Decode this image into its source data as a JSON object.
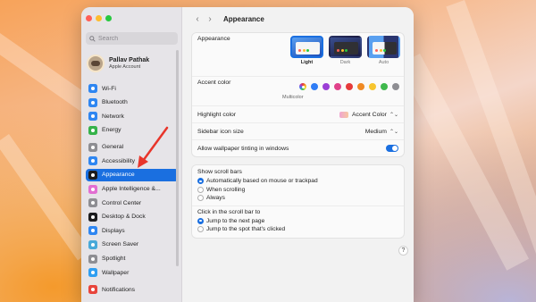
{
  "window": {
    "title": "Appearance"
  },
  "sidebar": {
    "search_placeholder": "Search",
    "account": {
      "name": "Pallav Pathak",
      "subtitle": "Apple Account"
    },
    "items": [
      {
        "label": "Wi-Fi",
        "icon": "wifi-icon",
        "color": "#2f86f1",
        "gap": false
      },
      {
        "label": "Bluetooth",
        "icon": "bluetooth-icon",
        "color": "#2f86f1",
        "gap": false
      },
      {
        "label": "Network",
        "icon": "network-icon",
        "color": "#2f86f1",
        "gap": false
      },
      {
        "label": "Energy",
        "icon": "energy-icon",
        "color": "#36b24a",
        "gap": false
      },
      {
        "label": "General",
        "icon": "gear-icon",
        "color": "#8e8e93",
        "gap": true
      },
      {
        "label": "Accessibility",
        "icon": "accessibility-icon",
        "color": "#2f86f1",
        "gap": false
      },
      {
        "label": "Appearance",
        "icon": "appearance-icon",
        "color": "#1c1c1e",
        "gap": false,
        "selected": true
      },
      {
        "label": "Apple Intelligence &...",
        "icon": "apple-intelligence-icon",
        "color": "#e26fd2",
        "gap": false
      },
      {
        "label": "Control Center",
        "icon": "control-center-icon",
        "color": "#8e8e93",
        "gap": false
      },
      {
        "label": "Desktop & Dock",
        "icon": "dock-icon",
        "color": "#1c1c1e",
        "gap": false
      },
      {
        "label": "Displays",
        "icon": "displays-icon",
        "color": "#2f86f1",
        "gap": false
      },
      {
        "label": "Screen Saver",
        "icon": "screen-saver-icon",
        "color": "#48a9d9",
        "gap": false
      },
      {
        "label": "Spotlight",
        "icon": "spotlight-icon",
        "color": "#8e8e93",
        "gap": false
      },
      {
        "label": "Wallpaper",
        "icon": "wallpaper-icon",
        "color": "#2f9ef1",
        "gap": false
      },
      {
        "label": "Notifications",
        "icon": "notifications-icon",
        "color": "#e8453c",
        "gap": true
      }
    ]
  },
  "appearance": {
    "label": "Appearance",
    "options": [
      {
        "label": "Light",
        "style": "light",
        "selected": true
      },
      {
        "label": "Dark",
        "style": "dark",
        "selected": false
      },
      {
        "label": "Auto",
        "style": "auto",
        "selected": false
      }
    ]
  },
  "accent": {
    "label": "Accent color",
    "selected_label": "Multicolor",
    "colors": [
      "multicolor",
      "#2f7df6",
      "#9b3fd6",
      "#e0428a",
      "#e63b3b",
      "#f08a24",
      "#f7c52f",
      "#3fb84c",
      "#8e8e93"
    ]
  },
  "highlight": {
    "label": "Highlight color",
    "value": "Accent Color"
  },
  "icon_size": {
    "label": "Sidebar icon size",
    "value": "Medium"
  },
  "tinting": {
    "label": "Allow wallpaper tinting in windows",
    "enabled": true
  },
  "scroll_bars": {
    "title": "Show scroll bars",
    "options": [
      {
        "label": "Automatically based on mouse or trackpad",
        "selected": true
      },
      {
        "label": "When scrolling",
        "selected": false
      },
      {
        "label": "Always",
        "selected": false
      }
    ]
  },
  "click_scroll": {
    "title": "Click in the scroll bar to",
    "options": [
      {
        "label": "Jump to the next page",
        "selected": true
      },
      {
        "label": "Jump to the spot that's clicked",
        "selected": false
      }
    ]
  },
  "help": {
    "label": "?"
  },
  "colors": {
    "accent": "#1a6fe0",
    "annotation_arrow": "#e8352b"
  }
}
